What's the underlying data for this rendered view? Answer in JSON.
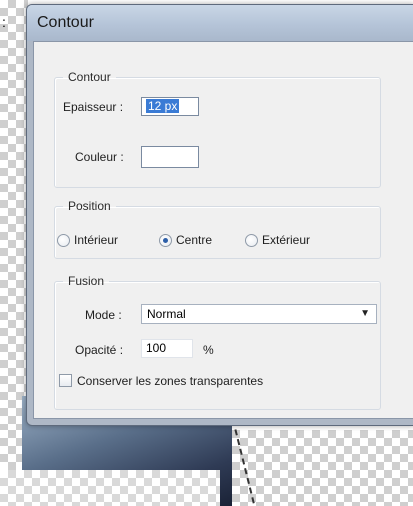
{
  "window": {
    "title": "Contour"
  },
  "contour": {
    "legend": "Contour",
    "thickness_label": "Epaisseur :",
    "thickness_value": "12 px",
    "color_label": "Couleur :"
  },
  "position": {
    "legend": "Position",
    "options": [
      "Intérieur",
      "Centre",
      "Extérieur"
    ],
    "selected": "Centre"
  },
  "fusion": {
    "legend": "Fusion",
    "mode_label": "Mode :",
    "mode_value": "Normal",
    "opacity_label": "Opacité :",
    "opacity_value": "100",
    "opacity_unit": "%",
    "preserve_label": "Conserver les zones transparentes",
    "preserve_checked": false
  },
  "background": {
    "marker_text": ":"
  }
}
